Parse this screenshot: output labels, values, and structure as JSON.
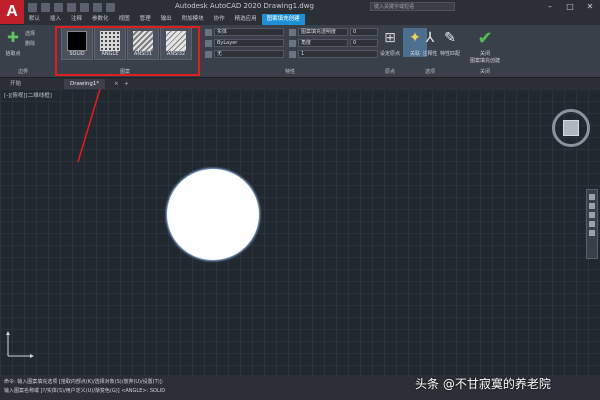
{
  "app": {
    "logo_letter": "A",
    "title": "Autodesk AutoCAD 2020    Drawing1.dwg",
    "search_placeholder": "键入关键字或短语"
  },
  "menu_tabs": [
    "默认",
    "插入",
    "注释",
    "参数化",
    "视图",
    "管理",
    "输出",
    "附加模块",
    "协作",
    "精选应用",
    "图案填充创建"
  ],
  "active_menu_tab": "图案填充创建",
  "ribbon": {
    "boundary": {
      "pick_point": "拾取点",
      "select": "选择",
      "remove": "删除",
      "panel_label": "边界"
    },
    "patterns": [
      {
        "name": "SOLID",
        "style": "solid"
      },
      {
        "name": "ANGLE",
        "style": "dots"
      },
      {
        "name": "ANSI31",
        "style": "diag"
      },
      {
        "name": "ANSI32",
        "style": "diag2"
      }
    ],
    "pattern_panel_label": "图案",
    "properties": {
      "pattern_type": "实体",
      "color": "ByLayer",
      "background": "无",
      "transparency_label": "图案填充透明度",
      "transparency_value": "0",
      "angle_label": "角度",
      "angle_value": "0",
      "scale_value": "1",
      "panel_label": "特性"
    },
    "origin": {
      "set_origin": "设定原点",
      "panel_label": "原点"
    },
    "options": {
      "associative": "关联",
      "annotative": "注释性",
      "match": "特性匹配",
      "panel_label": "选项"
    },
    "close": {
      "label": "关闭\n图案填充创建",
      "panel_label": "关闭"
    }
  },
  "file_tabs": [
    {
      "label": "开始"
    },
    {
      "label": "Drawing1*"
    }
  ],
  "viewport_label": "[-][俯视][二维线框]",
  "command_lines": [
    "命令: 输入图案填充选项 [拾取内部点(K)/选择对象(S)/放弃(U)/设置(T)]:",
    "输入图案名称或 [?/实体(S)/用户定义(U)/渐变色(G)] <ANGLE>: SOLID"
  ],
  "watermark": "头条 @不甘寂寞的养老院",
  "colors": {
    "accent": "#1e90d6",
    "annotation": "#e21d1d",
    "canvas": "#212830"
  }
}
